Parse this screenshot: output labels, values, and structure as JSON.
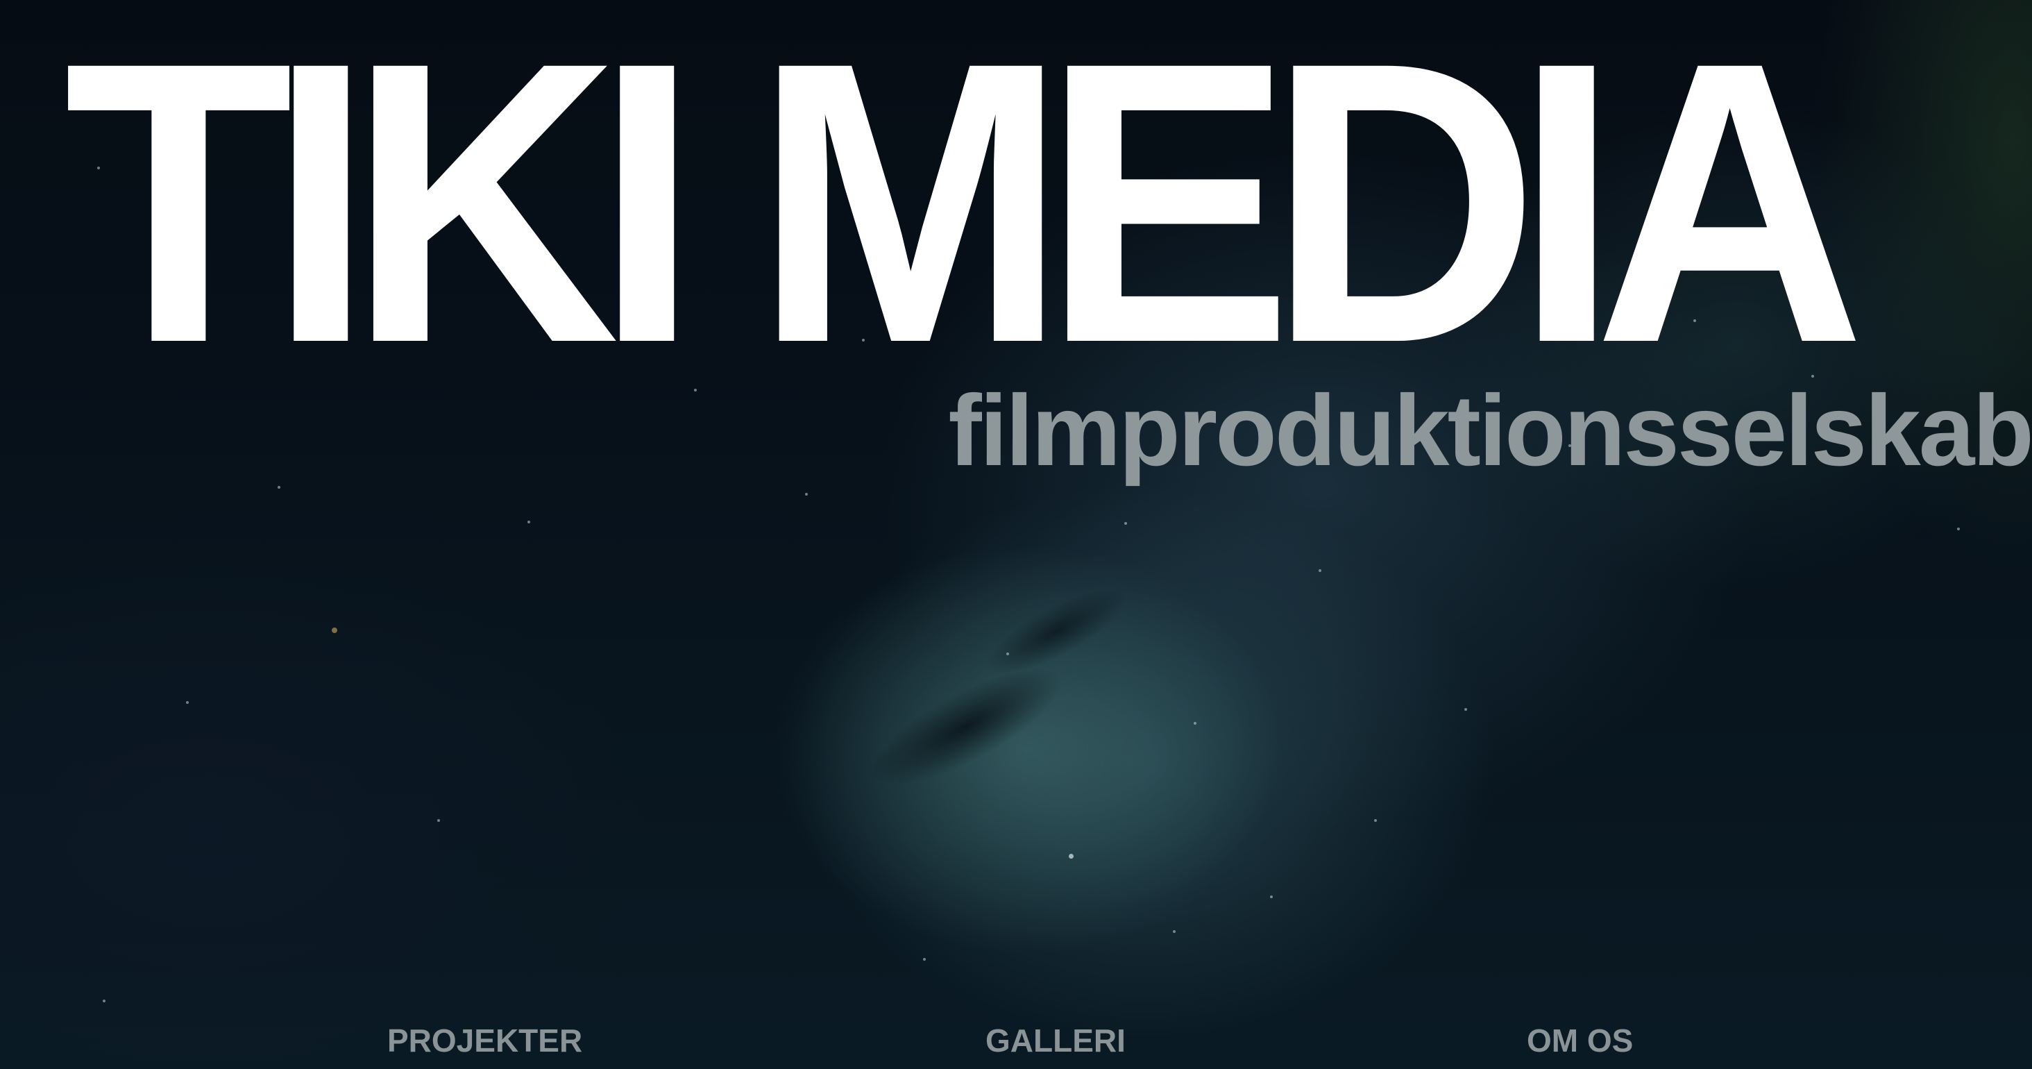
{
  "brand": {
    "title": "TIKI MEDIA",
    "tagline": "filmproduktionsselskab"
  },
  "nav": {
    "items": [
      {
        "label": "PROJEKTER"
      },
      {
        "label": "GALLERI"
      },
      {
        "label": "OM OS"
      }
    ]
  },
  "colors": {
    "title": "#ffffff",
    "tagline": "#8e989b",
    "nav": "#8a9396",
    "background": "#050b12"
  }
}
